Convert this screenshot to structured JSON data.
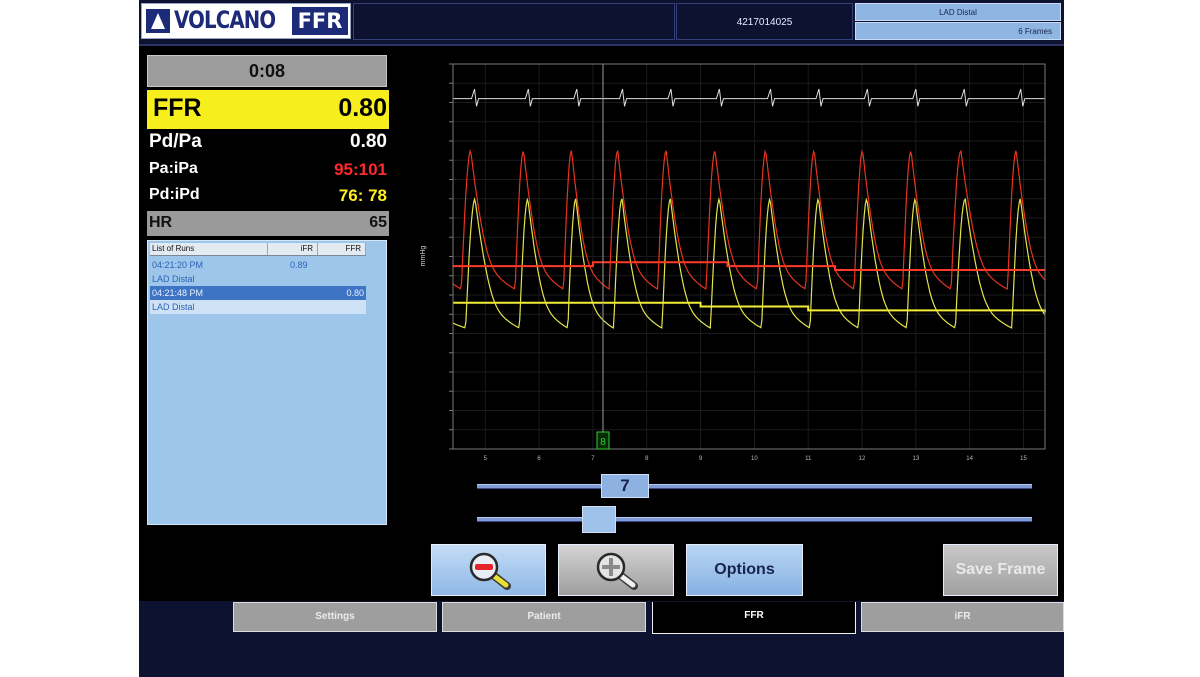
{
  "header": {
    "logo_text": "VOLCANO",
    "logo_badge": "FFR",
    "patient_id": "4217014025",
    "vessel": "LAD Distal",
    "frames": "6 Frames"
  },
  "readouts": {
    "timer": "0:08",
    "ffr_label": "FFR",
    "ffr_value": "0.80",
    "pdpa_label": "Pd/Pa",
    "pdpa_value": "0.80",
    "paipa_label": "Pa:iPa",
    "paipa_value": "95:101",
    "pdipd_label": "Pd:iPd",
    "pdipd_value": "76: 78",
    "hr_label": "HR",
    "hr_value": "65",
    "colors": {
      "ffr_highlight": "#f7ee1e",
      "pa": "#ff2a2a",
      "pd": "#ffee22"
    }
  },
  "runs": {
    "columns": [
      "List of Runs",
      "iFR",
      "FFR"
    ],
    "rows": [
      {
        "time": "04:21:20 PM",
        "ifr": "0.89",
        "ffr": "",
        "vessel": "LAD Distal",
        "selected": false
      },
      {
        "time": "04:21:48 PM",
        "ifr": "",
        "ffr": "0.80",
        "vessel": "LAD Distal",
        "selected": true
      }
    ]
  },
  "chart": {
    "ylabel": "mmHg",
    "x_ticks": [
      "5",
      "6",
      "7",
      "8",
      "9",
      "10",
      "11",
      "12",
      "13",
      "14",
      "15"
    ],
    "marker_label": "8",
    "slider_label": "7",
    "colors": {
      "pa": "#e8331f",
      "pd": "#e3e54a",
      "pa_mean": "#ff3a2a",
      "pd_mean": "#f2ee38",
      "ecg": "#dddddd"
    }
  },
  "chart_data": {
    "type": "line",
    "xlabel": "",
    "ylabel": "mmHg",
    "x_ticks": [
      "5",
      "6",
      "7",
      "8",
      "9",
      "10",
      "11",
      "12",
      "13",
      "14",
      "15"
    ],
    "xlim": [
      4.4,
      15.4
    ],
    "ylim": [
      0,
      200
    ],
    "beat_times": [
      4.55,
      5.55,
      6.45,
      7.3,
      8.2,
      9.1,
      10.05,
      10.95,
      11.85,
      12.75,
      13.65,
      14.7
    ],
    "series": [
      {
        "name": "Pa",
        "systolic": 155,
        "diastolic": 80,
        "mean": [
          {
            "x": 4.4,
            "y": 95
          },
          {
            "x": 7.0,
            "y": 97
          },
          {
            "x": 9.5,
            "y": 95
          },
          {
            "x": 11.5,
            "y": 93
          },
          {
            "x": 15.4,
            "y": 93
          }
        ]
      },
      {
        "name": "Pd",
        "systolic": 130,
        "diastolic": 60,
        "mean": [
          {
            "x": 4.4,
            "y": 76
          },
          {
            "x": 7.8,
            "y": 76
          },
          {
            "x": 9.0,
            "y": 74
          },
          {
            "x": 11.0,
            "y": 72
          },
          {
            "x": 15.4,
            "y": 71
          }
        ]
      }
    ]
  },
  "controls": {
    "options_label": "Options",
    "save_frame_label": "Save Frame"
  },
  "tabs": [
    {
      "label": "Settings",
      "active": false
    },
    {
      "label": "Patient",
      "active": false
    },
    {
      "label": "FFR",
      "active": true
    },
    {
      "label": "iFR",
      "active": false
    }
  ]
}
